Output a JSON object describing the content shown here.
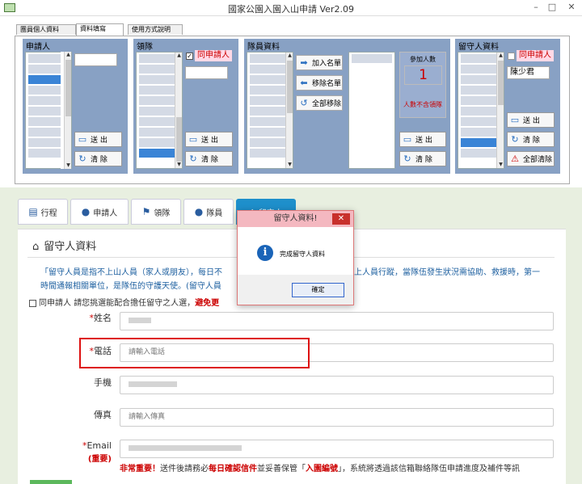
{
  "window": {
    "title": "國家公園入園入山申請 Ver2.09"
  },
  "tabs": [
    {
      "label": "團員個人資料"
    },
    {
      "label": "資料填寫"
    },
    {
      "label": "使用方式說明"
    }
  ],
  "groups": {
    "applicant": {
      "title": "申請人"
    },
    "leader": {
      "title": "領隊",
      "same_label": "同申請人"
    },
    "members": {
      "title": "隊員資料",
      "count_label": "參加人數",
      "count_value": "1",
      "count_note": "人數不含領隊",
      "add_label": "加入名單",
      "remove_label": "移除名單",
      "remove_all_label": "全部移除"
    },
    "guardian": {
      "title": "留守人資料",
      "same_label": "同申請人",
      "name_value": "陳少君",
      "clear_all_label": "全部清除"
    }
  },
  "buttons": {
    "send": "送 出",
    "clear": "清 除"
  },
  "nav": [
    {
      "label": "行程"
    },
    {
      "label": "申請人"
    },
    {
      "label": "領隊"
    },
    {
      "label": "隊員"
    },
    {
      "label": "留守人"
    }
  ],
  "section": {
    "title": "留守人資料"
  },
  "description": {
    "line1": "「留守人員是指不上山人員（家人或朋友），每日不",
    "line1b": "上人員行蹤，當隊伍發生狀況需協助、救援時，第一",
    "line2": "時間通報相關單位，是隊伍的守護天使。(留守人員"
  },
  "same_applicant": {
    "label": "同申請人",
    "text": "請您挑選能配合擔任留守之人選，",
    "warn": "避免更"
  },
  "form": {
    "name_label": "姓名",
    "req": "*",
    "phone_label": "電話",
    "phone_placeholder": "請輸入電話",
    "mobile_label": "手機",
    "fax_label": "傳真",
    "fax_placeholder": "請輸入傳真",
    "email_label": "Email",
    "email_sub": "(重要)"
  },
  "note": {
    "r1": "非常重要！",
    "t1": "送件後請務必",
    "r2": "每日確認信件",
    "t2": "並妥善保管「",
    "r3": "入園編號",
    "t3": "」，系統將透過該信箱聯絡隊伍申請進度及補件等訊"
  },
  "dialog": {
    "title": "留守人資料!",
    "message": "完成留守人資料",
    "ok": "確定"
  }
}
